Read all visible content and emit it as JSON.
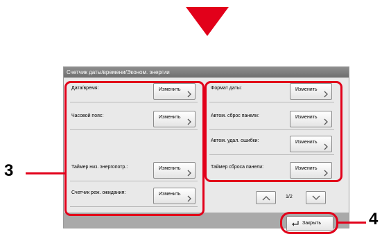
{
  "colors": {
    "accent": "#e2001a",
    "titlebar": "#7a7a7a",
    "panel": "#e9e9e9",
    "bottombar": "#a9a9a9"
  },
  "window": {
    "title": "Счетчик даты/времени/Эконом. энергии"
  },
  "items": [
    {
      "label": "Дата/время:",
      "button": "Изменить"
    },
    {
      "label": "Формат даты:",
      "button": "Изменить"
    },
    {
      "label": "Часовой пояс:",
      "button": "Изменить"
    },
    {
      "label": "Автом. сброс панели:",
      "button": "Изменить"
    },
    {
      "label": "Автом. удал. ошибки:",
      "button": "Изменить"
    },
    {
      "label": "Таймер низ. энергопотр.:",
      "button": "Изменить"
    },
    {
      "label": "Таймер сброса панели:",
      "button": "Изменить"
    },
    {
      "label": "Счетчик реж. ожидания:",
      "button": "Изменить"
    }
  ],
  "pagination": {
    "page": "1/2",
    "prev_icon": "chevron-up-icon",
    "next_icon": "chevron-down-icon"
  },
  "close": {
    "label": "Закрыть",
    "icon": "return-arrow-icon"
  },
  "callouts": {
    "left": "3",
    "right": "4"
  },
  "icons": {
    "step_arrow": "down-triangle-icon",
    "chevron": "chevron-right-icon"
  }
}
